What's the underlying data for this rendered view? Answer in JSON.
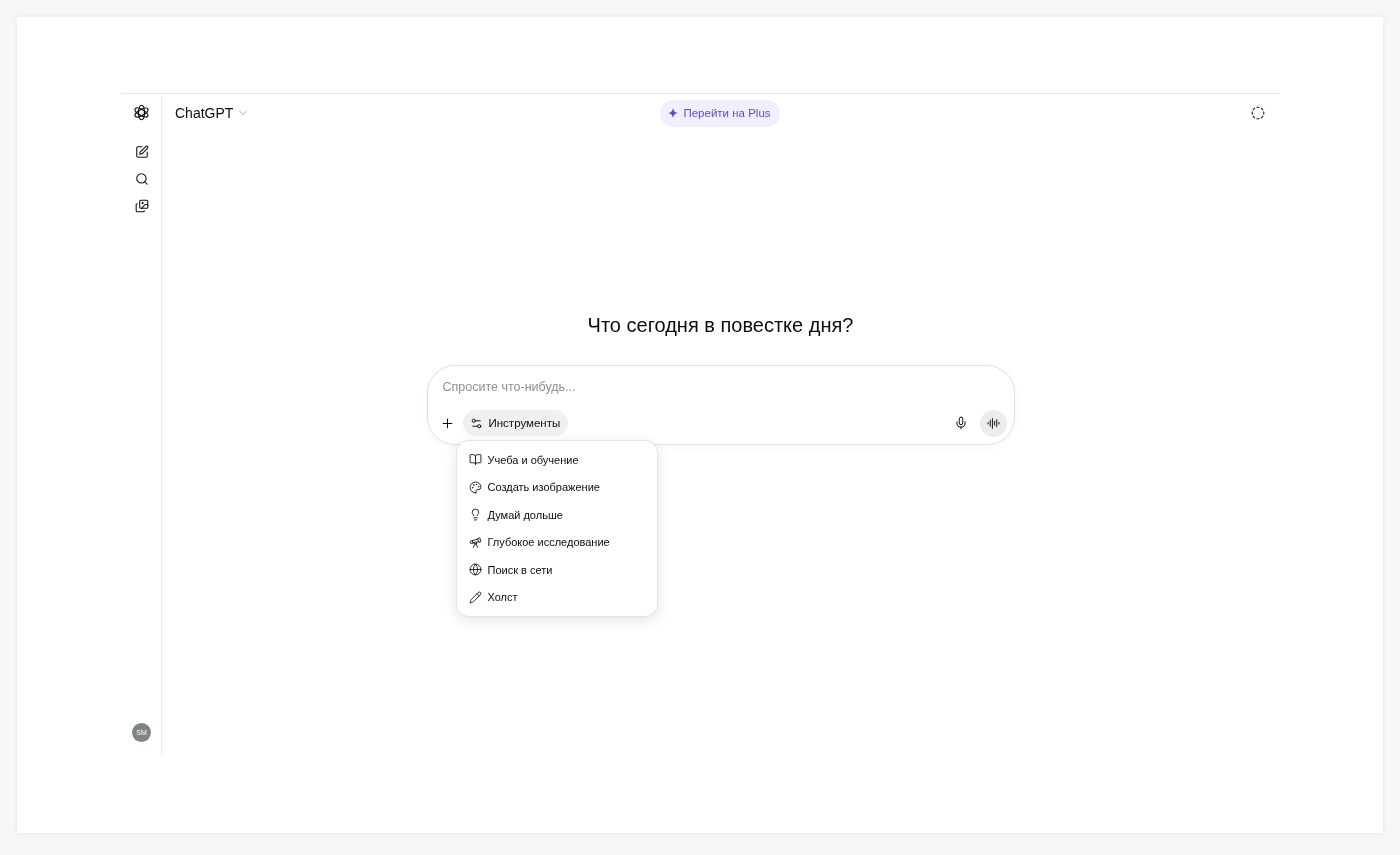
{
  "sidebar": {
    "avatar": {
      "initials": "SM"
    }
  },
  "header": {
    "title": "ChatGPT",
    "upgrade_button": "Перейти на Plus"
  },
  "heading": "Что сегодня в повестке дня?",
  "composer": {
    "placeholder": "Спросите что-нибудь...",
    "tools_button": {
      "label": "Инструменты",
      "expanded": true
    }
  },
  "tools_menu": {
    "items": [
      "Учеба и обучение",
      "Создать изображение",
      "Думай дольше",
      "Глубокое исследование",
      "Поиск в сети",
      "Холст"
    ]
  }
}
